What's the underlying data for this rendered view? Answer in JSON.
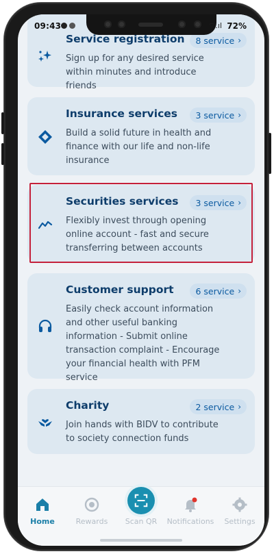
{
  "status_bar": {
    "time": "09:43",
    "battery": "72%",
    "signal": "⌔.ıl"
  },
  "cards": [
    {
      "title": "Service registration",
      "badge": "8 service",
      "desc": "Sign up for any desired service within minutes and introduce friends",
      "icon": "sparkle-icon"
    },
    {
      "title": "Insurance services",
      "badge": "3 service",
      "desc": "Build a solid future in health and finance with our life and non-life insurance",
      "icon": "shield-diamond-icon"
    },
    {
      "title": "Securities services",
      "badge": "3 service",
      "desc": "Flexibly invest through opening online account - fast and secure transferring between accounts",
      "icon": "trend-line-icon"
    },
    {
      "title": "Customer support",
      "badge": "6 service",
      "desc": "Easily check account information and other useful banking information - Submit online transaction complaint - Encourage your financial health with PFM service",
      "icon": "headset-icon"
    },
    {
      "title": "Charity",
      "badge": "2 service",
      "desc": "Join hands with BIDV to contribute to society connection funds",
      "icon": "hands-heart-icon"
    }
  ],
  "nav": {
    "home": "Home",
    "rewards": "Rewards",
    "scan": "Scan QR",
    "notifications": "Notifications",
    "settings": "Settings"
  },
  "colors": {
    "accent": "#0b5aa0",
    "card": "#dde8f1",
    "highlight": "#c4203a",
    "nav_active": "#1b7fa8"
  }
}
